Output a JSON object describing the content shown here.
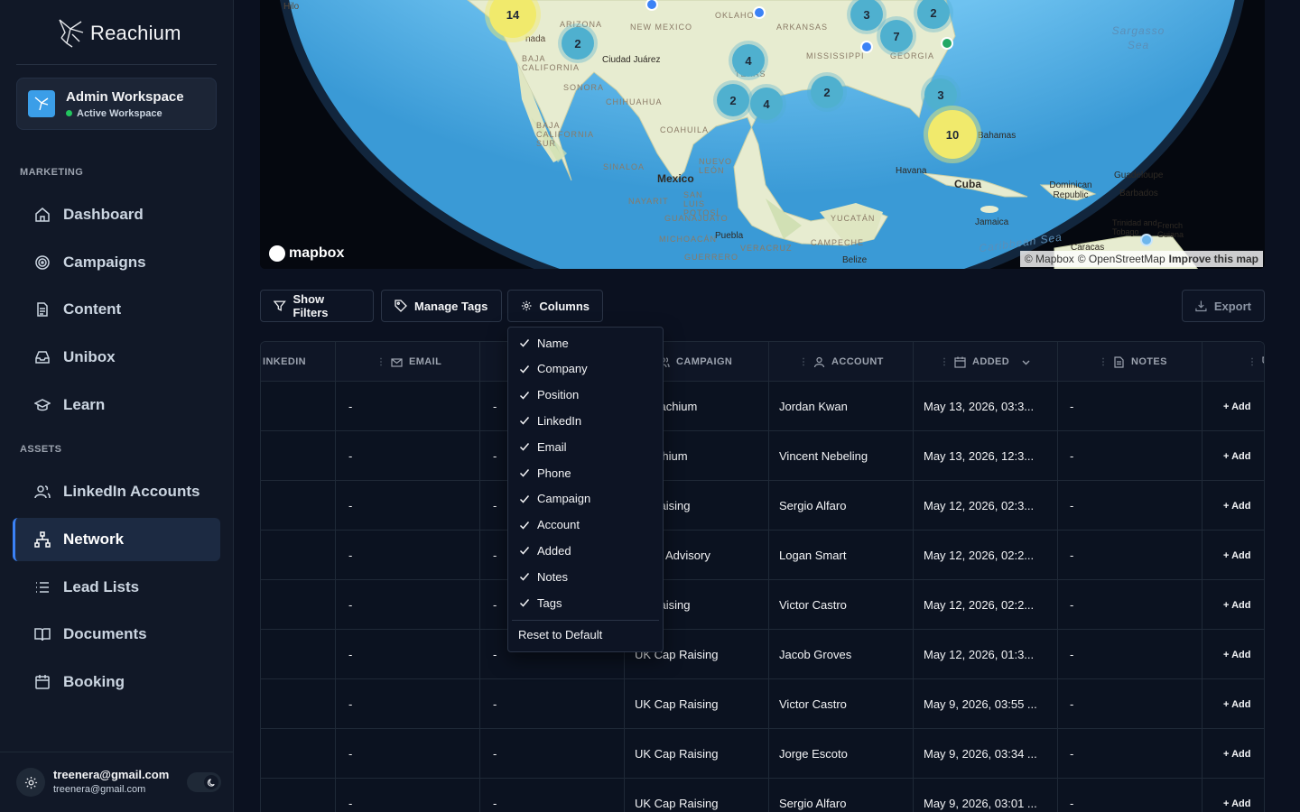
{
  "app": {
    "name": "Reachium"
  },
  "workspace": {
    "title": "Admin Workspace",
    "status": "Active Workspace"
  },
  "sidebar": {
    "sections": [
      {
        "label": "MARKETING"
      },
      {
        "label": "ASSETS"
      }
    ],
    "items": [
      {
        "label": "Dashboard",
        "icon": "home-icon"
      },
      {
        "label": "Campaigns",
        "icon": "target-icon"
      },
      {
        "label": "Content",
        "icon": "document-icon"
      },
      {
        "label": "Unibox",
        "icon": "inbox-icon"
      },
      {
        "label": "Learn",
        "icon": "graduation-cap-icon"
      },
      {
        "label": "LinkedIn Accounts",
        "icon": "users-icon"
      },
      {
        "label": "Network",
        "icon": "network-icon",
        "active": true
      },
      {
        "label": "Lead Lists",
        "icon": "list-icon"
      },
      {
        "label": "Documents",
        "icon": "book-icon"
      },
      {
        "label": "Booking",
        "icon": "calendar-icon"
      }
    ]
  },
  "user": {
    "email": "treenera@gmail.com",
    "sub": "treenera@gmail.com"
  },
  "map": {
    "logo": "mapbox",
    "attribution": [
      "© Mapbox",
      "© OpenStreetMap",
      "Improve this map"
    ],
    "clusters": [
      {
        "count": "14",
        "color": "yellow"
      },
      {
        "count": "2",
        "color": "teal"
      },
      {
        "count": "4",
        "color": "teal"
      },
      {
        "count": "2",
        "color": "teal"
      },
      {
        "count": "4",
        "color": "teal"
      },
      {
        "count": "2",
        "color": "teal"
      },
      {
        "count": "3",
        "color": "teal"
      },
      {
        "count": "7",
        "color": "teal"
      },
      {
        "count": "2",
        "color": "teal"
      },
      {
        "count": "3",
        "color": "teal"
      },
      {
        "count": "10",
        "color": "yellow"
      }
    ],
    "labels": {
      "mexico": "Mexico",
      "cuba": "Cuba",
      "havana": "Havana",
      "bahamas": "Bahamas",
      "sargasso": "Sargasso Sea",
      "caribbean": "Caribbean Sea",
      "ciudad_juarez": "Ciudad Juárez",
      "puebla": "Puebla",
      "jamaica": "Jamaica",
      "belize": "Belize",
      "caracas": "Caracas",
      "dominican": "Dominican Republic",
      "guadeloupe": "Guadeloupe",
      "barbados": "Barbados",
      "trinidad": "Trinidad and Tobago",
      "guiana": "French Guiana",
      "hilo": "Hilo",
      "nada": "nada",
      "arizona": "ARIZONA",
      "new_mexico": "NEW MEXICO",
      "oklahoma": "OKLAHO",
      "arkansas": "ARKANSAS",
      "texas": "TEXAS",
      "mississippi": "MISSISSIPPI",
      "georgia": "GEORGIA",
      "sonora": "SONORA",
      "chihuahua": "CHIHUAHUA",
      "coahuila": "COAHUILA",
      "baja_california": "BAJA CALIFORNIA",
      "baja_california_sur": "BAJA CALIFORNIA SUR",
      "sinaloa": "SINALOA",
      "nuevo_leon": "NUEVO LEÓN",
      "nayarit": "NAYARIT",
      "san_luis": "SAN LUIS POTOSÍ",
      "guanajuato": "GUANAJUATO",
      "michoacan": "MICHOACÁN",
      "guerrero": "GUERRERO",
      "veracruz": "VERACRUZ",
      "campeche": "CAMPECHE",
      "yucatan": "YUCATÁN"
    }
  },
  "toolbar": {
    "show_filters": "Show Filters",
    "manage_tags": "Manage Tags",
    "columns": "Columns",
    "export": "Export"
  },
  "table": {
    "headers": {
      "linkedin": "INKEDIN",
      "email": "EMAIL",
      "campaign": "CAMPAIGN",
      "account": "ACCOUNT",
      "added": "ADDED",
      "notes": "NOTES"
    },
    "add_label": "+ Add",
    "rows": [
      {
        "linkedin": "",
        "email": "-",
        "phone": "-",
        "campaign": "n Reachium",
        "account": "Jordan Kwan",
        "added": "May 13, 2026, 03:3...",
        "notes": "-"
      },
      {
        "linkedin": "",
        "email": "-",
        "phone": "-",
        "campaign": "Reachium",
        "account": "Vincent Nebeling",
        "added": "May 13, 2026, 12:3...",
        "notes": "-"
      },
      {
        "linkedin": "",
        "email": "-",
        "phone": "-",
        "campaign": "ap Raising",
        "account": "Sergio Alfaro",
        "added": "May 12, 2026, 02:3...",
        "notes": "-"
      },
      {
        "linkedin": "",
        "email": "-",
        "phone": "-",
        "campaign": "apital Advisory",
        "account": "Logan Smart",
        "added": "May 12, 2026, 02:2...",
        "notes": "-"
      },
      {
        "linkedin": "",
        "email": "-",
        "phone": "-",
        "campaign": "ap Raising",
        "account": "Victor Castro",
        "added": "May 12, 2026, 02:2...",
        "notes": "-"
      },
      {
        "linkedin": "",
        "email": "-",
        "phone": "-",
        "campaign": "UK Cap Raising",
        "account": "Jacob Groves",
        "added": "May 12, 2026, 01:3...",
        "notes": "-"
      },
      {
        "linkedin": "",
        "email": "-",
        "phone": "-",
        "campaign": "UK Cap Raising",
        "account": "Victor Castro",
        "added": "May 9, 2026, 03:55 ...",
        "notes": "-"
      },
      {
        "linkedin": "",
        "email": "-",
        "phone": "-",
        "campaign": "UK Cap Raising",
        "account": "Jorge Escoto",
        "added": "May 9, 2026, 03:34 ...",
        "notes": "-"
      },
      {
        "linkedin": "",
        "email": "-",
        "phone": "-",
        "campaign": "UK Cap Raising",
        "account": "Sergio Alfaro",
        "added": "May 9, 2026, 03:01 ...",
        "notes": "-"
      }
    ]
  },
  "columns_menu": {
    "items": [
      "Name",
      "Company",
      "Position",
      "LinkedIn",
      "Email",
      "Phone",
      "Campaign",
      "Account",
      "Added",
      "Notes",
      "Tags"
    ],
    "reset": "Reset to Default"
  },
  "colors": {
    "accent": "#3b82f6",
    "sidebar_bg": "#111827",
    "page_bg": "#0b1120",
    "cluster_teal": "#4fb0cf",
    "cluster_yellow": "#f1ea6c",
    "online": "#22c55e"
  }
}
